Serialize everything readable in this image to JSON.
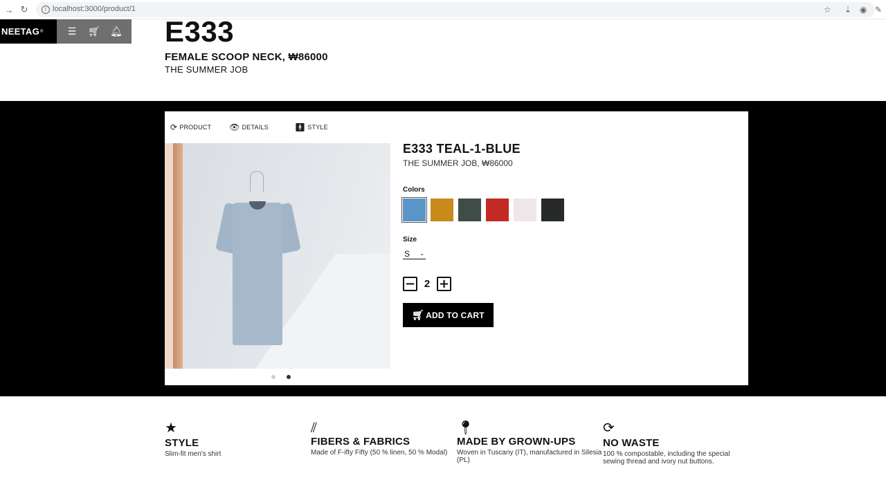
{
  "browser": {
    "url": "localhost:3000/product/1",
    "icons": [
      "forward-icon",
      "reload-icon",
      "info-icon",
      "star-icon",
      "extension-icon",
      "profile-icon",
      "pen-icon"
    ]
  },
  "app_bar": {
    "logo": "NEETAG",
    "logo_mark": "®",
    "tools": [
      {
        "icon": "menu-icon"
      },
      {
        "icon": "cart-icon"
      },
      {
        "icon": "notification-icon"
      }
    ]
  },
  "hero": {
    "code": "E333",
    "subtitle": "FEMALE SCOOP NECK, ₩86000",
    "collection": "THE SUMMER JOB"
  },
  "tabs": [
    {
      "label": "PRODUCT",
      "icon": "refresh-icon"
    },
    {
      "label": "DETAILS",
      "icon": "eye-icon"
    },
    {
      "label": "STYLE",
      "icon": "person-icon"
    }
  ],
  "carousel": {
    "count": 2,
    "active": 1
  },
  "product": {
    "name": "E333 TEAL-1-BLUE",
    "meta": "THE SUMMER JOB, ₩86000",
    "colors_label": "Colors",
    "colors": [
      {
        "name": "blue",
        "hex": "#5a95c8"
      },
      {
        "name": "mustard",
        "hex": "#c98a1c"
      },
      {
        "name": "dark-green",
        "hex": "#3f4c47"
      },
      {
        "name": "red",
        "hex": "#c42a24"
      },
      {
        "name": "light-pink",
        "hex": "#efe6e8"
      },
      {
        "name": "black",
        "hex": "#272a29"
      }
    ],
    "selected_color": 0,
    "size_label": "Size",
    "size_value": "S",
    "quantity": "2",
    "add_to_cart": "ADD TO CART"
  },
  "features": [
    {
      "icon": "star-icon",
      "title": "STYLE",
      "desc": "Slim-fit men's shirt"
    },
    {
      "icon": "fiber-icon",
      "title": "FIBERS & FABRICS",
      "desc": "Made of F-ifty Fifty (50 % linen, 50 % Modal)"
    },
    {
      "icon": "location-pin-icon",
      "title": "MADE BY GROWN-UPS",
      "desc": "Woven in Tuscany (IT), manufactured in Silesia (PL)"
    },
    {
      "icon": "recycle-icon",
      "title": "NO WASTE",
      "desc": "100 % compostable, including the special sewing thread and ivory nut buttons."
    }
  ]
}
